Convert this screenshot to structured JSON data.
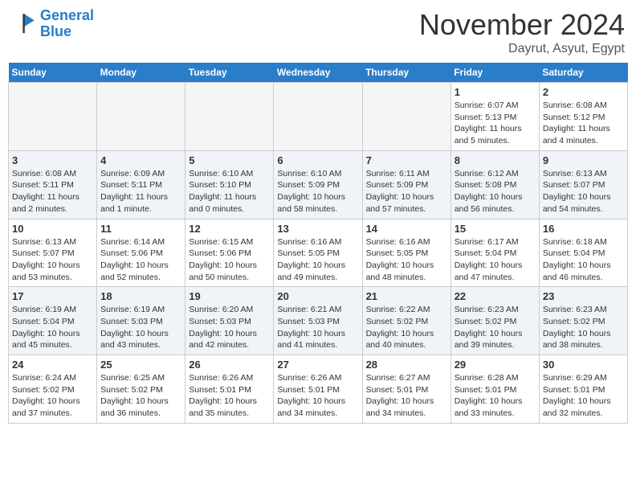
{
  "header": {
    "logo_line1": "General",
    "logo_line2": "Blue",
    "month": "November 2024",
    "location": "Dayrut, Asyut, Egypt"
  },
  "weekdays": [
    "Sunday",
    "Monday",
    "Tuesday",
    "Wednesday",
    "Thursday",
    "Friday",
    "Saturday"
  ],
  "weeks": [
    [
      {
        "day": "",
        "info": ""
      },
      {
        "day": "",
        "info": ""
      },
      {
        "day": "",
        "info": ""
      },
      {
        "day": "",
        "info": ""
      },
      {
        "day": "",
        "info": ""
      },
      {
        "day": "1",
        "info": "Sunrise: 6:07 AM\nSunset: 5:13 PM\nDaylight: 11 hours\nand 5 minutes."
      },
      {
        "day": "2",
        "info": "Sunrise: 6:08 AM\nSunset: 5:12 PM\nDaylight: 11 hours\nand 4 minutes."
      }
    ],
    [
      {
        "day": "3",
        "info": "Sunrise: 6:08 AM\nSunset: 5:11 PM\nDaylight: 11 hours\nand 2 minutes."
      },
      {
        "day": "4",
        "info": "Sunrise: 6:09 AM\nSunset: 5:11 PM\nDaylight: 11 hours\nand 1 minute."
      },
      {
        "day": "5",
        "info": "Sunrise: 6:10 AM\nSunset: 5:10 PM\nDaylight: 11 hours\nand 0 minutes."
      },
      {
        "day": "6",
        "info": "Sunrise: 6:10 AM\nSunset: 5:09 PM\nDaylight: 10 hours\nand 58 minutes."
      },
      {
        "day": "7",
        "info": "Sunrise: 6:11 AM\nSunset: 5:09 PM\nDaylight: 10 hours\nand 57 minutes."
      },
      {
        "day": "8",
        "info": "Sunrise: 6:12 AM\nSunset: 5:08 PM\nDaylight: 10 hours\nand 56 minutes."
      },
      {
        "day": "9",
        "info": "Sunrise: 6:13 AM\nSunset: 5:07 PM\nDaylight: 10 hours\nand 54 minutes."
      }
    ],
    [
      {
        "day": "10",
        "info": "Sunrise: 6:13 AM\nSunset: 5:07 PM\nDaylight: 10 hours\nand 53 minutes."
      },
      {
        "day": "11",
        "info": "Sunrise: 6:14 AM\nSunset: 5:06 PM\nDaylight: 10 hours\nand 52 minutes."
      },
      {
        "day": "12",
        "info": "Sunrise: 6:15 AM\nSunset: 5:06 PM\nDaylight: 10 hours\nand 50 minutes."
      },
      {
        "day": "13",
        "info": "Sunrise: 6:16 AM\nSunset: 5:05 PM\nDaylight: 10 hours\nand 49 minutes."
      },
      {
        "day": "14",
        "info": "Sunrise: 6:16 AM\nSunset: 5:05 PM\nDaylight: 10 hours\nand 48 minutes."
      },
      {
        "day": "15",
        "info": "Sunrise: 6:17 AM\nSunset: 5:04 PM\nDaylight: 10 hours\nand 47 minutes."
      },
      {
        "day": "16",
        "info": "Sunrise: 6:18 AM\nSunset: 5:04 PM\nDaylight: 10 hours\nand 46 minutes."
      }
    ],
    [
      {
        "day": "17",
        "info": "Sunrise: 6:19 AM\nSunset: 5:04 PM\nDaylight: 10 hours\nand 45 minutes."
      },
      {
        "day": "18",
        "info": "Sunrise: 6:19 AM\nSunset: 5:03 PM\nDaylight: 10 hours\nand 43 minutes."
      },
      {
        "day": "19",
        "info": "Sunrise: 6:20 AM\nSunset: 5:03 PM\nDaylight: 10 hours\nand 42 minutes."
      },
      {
        "day": "20",
        "info": "Sunrise: 6:21 AM\nSunset: 5:03 PM\nDaylight: 10 hours\nand 41 minutes."
      },
      {
        "day": "21",
        "info": "Sunrise: 6:22 AM\nSunset: 5:02 PM\nDaylight: 10 hours\nand 40 minutes."
      },
      {
        "day": "22",
        "info": "Sunrise: 6:23 AM\nSunset: 5:02 PM\nDaylight: 10 hours\nand 39 minutes."
      },
      {
        "day": "23",
        "info": "Sunrise: 6:23 AM\nSunset: 5:02 PM\nDaylight: 10 hours\nand 38 minutes."
      }
    ],
    [
      {
        "day": "24",
        "info": "Sunrise: 6:24 AM\nSunset: 5:02 PM\nDaylight: 10 hours\nand 37 minutes."
      },
      {
        "day": "25",
        "info": "Sunrise: 6:25 AM\nSunset: 5:02 PM\nDaylight: 10 hours\nand 36 minutes."
      },
      {
        "day": "26",
        "info": "Sunrise: 6:26 AM\nSunset: 5:01 PM\nDaylight: 10 hours\nand 35 minutes."
      },
      {
        "day": "27",
        "info": "Sunrise: 6:26 AM\nSunset: 5:01 PM\nDaylight: 10 hours\nand 34 minutes."
      },
      {
        "day": "28",
        "info": "Sunrise: 6:27 AM\nSunset: 5:01 PM\nDaylight: 10 hours\nand 34 minutes."
      },
      {
        "day": "29",
        "info": "Sunrise: 6:28 AM\nSunset: 5:01 PM\nDaylight: 10 hours\nand 33 minutes."
      },
      {
        "day": "30",
        "info": "Sunrise: 6:29 AM\nSunset: 5:01 PM\nDaylight: 10 hours\nand 32 minutes."
      }
    ]
  ]
}
